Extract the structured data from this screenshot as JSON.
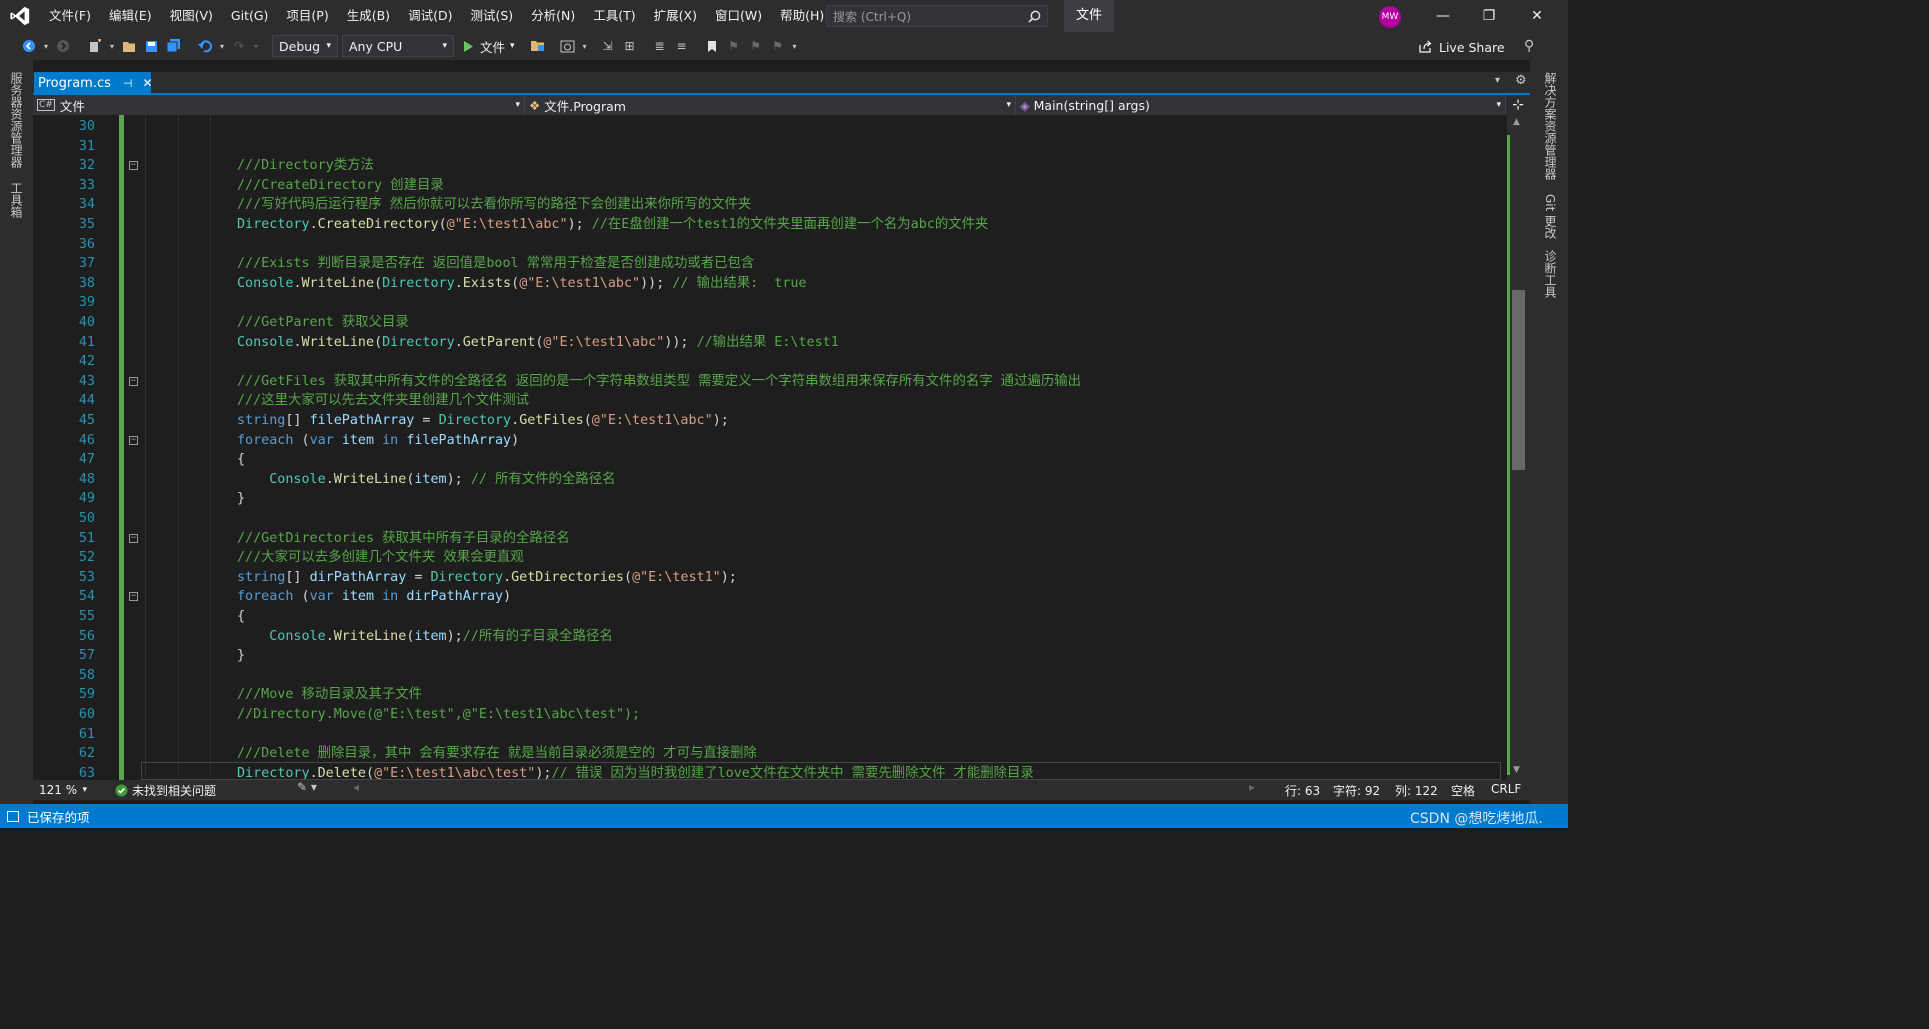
{
  "menubar": {
    "items": [
      "文件(F)",
      "编辑(E)",
      "视图(V)",
      "Git(G)",
      "项目(P)",
      "生成(B)",
      "调试(D)",
      "测试(S)",
      "分析(N)",
      "工具(T)",
      "扩展(X)",
      "窗口(W)",
      "帮助(H)"
    ],
    "search_placeholder": "搜索 (Ctrl+Q)",
    "solution_title": "文件",
    "avatar_initials": "MW"
  },
  "toolbar": {
    "config": "Debug",
    "platform": "Any CPU",
    "run_label": "文件",
    "live_share": "Live Share"
  },
  "tabs": {
    "active": "Program.cs"
  },
  "navbar": {
    "project": "文件",
    "class": "文件.Program",
    "member": "Main(string[] args)"
  },
  "side_left": [
    "服务器资源管理器",
    "工具箱"
  ],
  "side_right": [
    "解决方案资源管理器",
    "Git 更改",
    "诊断工具"
  ],
  "code_lines": [
    {
      "n": "30",
      "tokens": []
    },
    {
      "n": "31",
      "tokens": []
    },
    {
      "n": "32",
      "fold": true,
      "tokens": [
        [
          "c-cm",
          "///Directory类方法"
        ]
      ]
    },
    {
      "n": "33",
      "tokens": [
        [
          "c-cm",
          "///CreateDirectory 创建目录"
        ]
      ]
    },
    {
      "n": "34",
      "tokens": [
        [
          "c-cm",
          "///写好代码后运行程序 然后你就可以去看你所写的路径下会创建出来你所写的文件夹"
        ]
      ]
    },
    {
      "n": "35",
      "tokens": [
        [
          "c-ty",
          "Directory"
        ],
        [
          "c-df",
          "."
        ],
        [
          "c-fn",
          "CreateDirectory"
        ],
        [
          "c-df",
          "("
        ],
        [
          "c-st",
          "@\"E:\\test1\\abc\""
        ],
        [
          "c-df",
          "); "
        ],
        [
          "c-cm",
          "//在E盘创建一个test1的文件夹里面再创建一个名为abc的文件夹"
        ]
      ]
    },
    {
      "n": "36",
      "tokens": []
    },
    {
      "n": "37",
      "tokens": [
        [
          "c-cm",
          "///Exists 判断目录是否存在 返回值是bool 常常用于检查是否创建成功或者已包含"
        ]
      ]
    },
    {
      "n": "38",
      "tokens": [
        [
          "c-ty",
          "Console"
        ],
        [
          "c-df",
          "."
        ],
        [
          "c-fn",
          "WriteLine"
        ],
        [
          "c-df",
          "("
        ],
        [
          "c-ty",
          "Directory"
        ],
        [
          "c-df",
          "."
        ],
        [
          "c-fn",
          "Exists"
        ],
        [
          "c-df",
          "("
        ],
        [
          "c-st",
          "@\"E:\\test1\\abc\""
        ],
        [
          "c-df",
          ")); "
        ],
        [
          "c-cm",
          "// 输出结果:  true"
        ]
      ]
    },
    {
      "n": "39",
      "tokens": []
    },
    {
      "n": "40",
      "tokens": [
        [
          "c-cm",
          "///GetParent 获取父目录"
        ]
      ]
    },
    {
      "n": "41",
      "tokens": [
        [
          "c-ty",
          "Console"
        ],
        [
          "c-df",
          "."
        ],
        [
          "c-fn",
          "WriteLine"
        ],
        [
          "c-df",
          "("
        ],
        [
          "c-ty",
          "Directory"
        ],
        [
          "c-df",
          "."
        ],
        [
          "c-fn",
          "GetParent"
        ],
        [
          "c-df",
          "("
        ],
        [
          "c-st",
          "@\"E:\\test1\\abc\""
        ],
        [
          "c-df",
          ")); "
        ],
        [
          "c-cm",
          "//输出结果 E:\\test1"
        ]
      ]
    },
    {
      "n": "42",
      "tokens": []
    },
    {
      "n": "43",
      "fold": true,
      "tokens": [
        [
          "c-cm",
          "///GetFiles 获取其中所有文件的全路径名 返回的是一个字符串数组类型 需要定义一个字符串数组用来保存所有文件的名字 通过遍历输出"
        ]
      ]
    },
    {
      "n": "44",
      "tokens": [
        [
          "c-cm",
          "///这里大家可以先去文件夹里创建几个文件测试"
        ]
      ]
    },
    {
      "n": "45",
      "tokens": [
        [
          "c-kw",
          "string"
        ],
        [
          "c-df",
          "[] "
        ],
        [
          "c-var",
          "filePathArray"
        ],
        [
          "c-df",
          " = "
        ],
        [
          "c-ty",
          "Directory"
        ],
        [
          "c-df",
          "."
        ],
        [
          "c-fn",
          "GetFiles"
        ],
        [
          "c-df",
          "("
        ],
        [
          "c-st",
          "@\"E:\\test1\\abc\""
        ],
        [
          "c-df",
          ");"
        ]
      ]
    },
    {
      "n": "46",
      "fold": true,
      "tokens": [
        [
          "c-kw",
          "foreach"
        ],
        [
          "c-df",
          " ("
        ],
        [
          "c-kw",
          "var"
        ],
        [
          "c-df",
          " "
        ],
        [
          "c-var",
          "item"
        ],
        [
          "c-df",
          " "
        ],
        [
          "c-kw",
          "in"
        ],
        [
          "c-df",
          " "
        ],
        [
          "c-var",
          "filePathArray"
        ],
        [
          "c-df",
          ")"
        ]
      ]
    },
    {
      "n": "47",
      "tokens": [
        [
          "c-df",
          "{"
        ]
      ]
    },
    {
      "n": "48",
      "tokens": [
        [
          "c-df",
          "    "
        ],
        [
          "c-ty",
          "Console"
        ],
        [
          "c-df",
          "."
        ],
        [
          "c-fn",
          "WriteLine"
        ],
        [
          "c-df",
          "("
        ],
        [
          "c-var",
          "item"
        ],
        [
          "c-df",
          "); "
        ],
        [
          "c-cm",
          "// 所有文件的全路径名"
        ]
      ]
    },
    {
      "n": "49",
      "tokens": [
        [
          "c-df",
          "}"
        ]
      ]
    },
    {
      "n": "50",
      "tokens": []
    },
    {
      "n": "51",
      "fold": true,
      "tokens": [
        [
          "c-cm",
          "///GetDirectories 获取其中所有子目录的全路径名"
        ]
      ]
    },
    {
      "n": "52",
      "tokens": [
        [
          "c-cm",
          "///大家可以去多创建几个文件夹 效果会更直观"
        ]
      ]
    },
    {
      "n": "53",
      "tokens": [
        [
          "c-kw",
          "string"
        ],
        [
          "c-df",
          "[] "
        ],
        [
          "c-var",
          "dirPathArray"
        ],
        [
          "c-df",
          " = "
        ],
        [
          "c-ty",
          "Directory"
        ],
        [
          "c-df",
          "."
        ],
        [
          "c-fn",
          "GetDirectories"
        ],
        [
          "c-df",
          "("
        ],
        [
          "c-st",
          "@\"E:\\test1\""
        ],
        [
          "c-df",
          ");"
        ]
      ]
    },
    {
      "n": "54",
      "fold": true,
      "tokens": [
        [
          "c-kw",
          "foreach"
        ],
        [
          "c-df",
          " ("
        ],
        [
          "c-kw",
          "var"
        ],
        [
          "c-df",
          " "
        ],
        [
          "c-var",
          "item"
        ],
        [
          "c-df",
          " "
        ],
        [
          "c-kw",
          "in"
        ],
        [
          "c-df",
          " "
        ],
        [
          "c-var",
          "dirPathArray"
        ],
        [
          "c-df",
          ")"
        ]
      ]
    },
    {
      "n": "55",
      "tokens": [
        [
          "c-df",
          "{"
        ]
      ]
    },
    {
      "n": "56",
      "tokens": [
        [
          "c-df",
          "    "
        ],
        [
          "c-ty",
          "Console"
        ],
        [
          "c-df",
          "."
        ],
        [
          "c-fn",
          "WriteLine"
        ],
        [
          "c-df",
          "("
        ],
        [
          "c-var",
          "item"
        ],
        [
          "c-df",
          ");"
        ],
        [
          "c-cm",
          "//所有的子目录全路径名"
        ]
      ]
    },
    {
      "n": "57",
      "tokens": [
        [
          "c-df",
          "}"
        ]
      ]
    },
    {
      "n": "58",
      "tokens": []
    },
    {
      "n": "59",
      "tokens": [
        [
          "c-cm",
          "///Move 移动目录及其子文件"
        ]
      ]
    },
    {
      "n": "60",
      "tokens": [
        [
          "c-cm",
          "//Directory.Move(@\"E:\\test\",@\"E:\\test1\\abc\\test\");"
        ]
      ]
    },
    {
      "n": "61",
      "tokens": []
    },
    {
      "n": "62",
      "tokens": [
        [
          "c-cm",
          "///Delete 删除目录，其中 会有要求存在 就是当前目录必须是空的 才可与直接删除"
        ]
      ]
    },
    {
      "n": "63",
      "tokens": [
        [
          "c-ty",
          "Directory"
        ],
        [
          "c-df",
          "."
        ],
        [
          "c-fn",
          "Delete"
        ],
        [
          "c-df",
          "("
        ],
        [
          "c-st",
          "@\"E:\\test1\\abc\\test\""
        ],
        [
          "c-df",
          ");"
        ],
        [
          "c-cm",
          "// 错误 因为当时我创建了love文件在文件夹中 需要先删除文件 才能删除目录"
        ]
      ]
    }
  ],
  "editor_status": {
    "zoom": "121 %",
    "issues": "未找到相关问题",
    "line": "行: 63",
    "char": "字符: 92",
    "col": "列: 122",
    "whitespace": "空格",
    "eol": "CRLF"
  },
  "statusbar": {
    "message": "已保存的项"
  },
  "watermark": "CSDN @想吃烤地瓜.",
  "colors": {
    "accent": "#007acc",
    "comment": "#57a64a",
    "keyword": "#569cd6",
    "type": "#4ec9b0",
    "method": "#dcdcaa",
    "string": "#d69d85"
  }
}
